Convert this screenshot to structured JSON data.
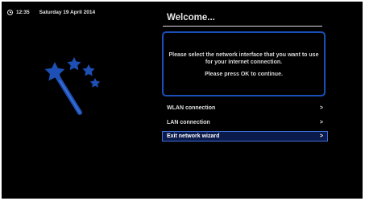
{
  "status": {
    "time": "12:35",
    "date": "Saturday 19 April 2014"
  },
  "wizard": {
    "title": "Welcome...",
    "info_line1": "Please select the network interface that you want to use for your internet connection.",
    "info_line2": "Please press OK to continue."
  },
  "menu": {
    "items": [
      {
        "label": "WLAN connection",
        "arrow": ">"
      },
      {
        "label": "LAN connection",
        "arrow": ">"
      },
      {
        "label": "Exit network wizard",
        "arrow": ">",
        "selected": true
      }
    ]
  },
  "colors": {
    "background": "#000000",
    "accent": "#1a4fb8",
    "selection": "#0a1a4a",
    "star": "#1e4fb4"
  }
}
